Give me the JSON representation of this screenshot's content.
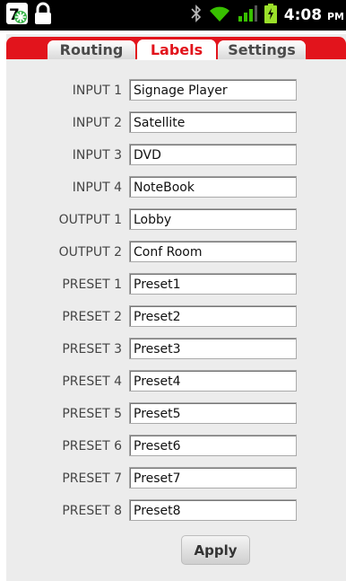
{
  "status_bar": {
    "time": "4:08",
    "ampm": "PM",
    "icons": [
      "launcher-icon",
      "lock-icon",
      "bluetooth-icon",
      "wifi-icon",
      "signal-icon",
      "battery-charging-icon"
    ]
  },
  "tabs": [
    {
      "label": "Routing",
      "active": false
    },
    {
      "label": "Labels",
      "active": true
    },
    {
      "label": "Settings",
      "active": false
    }
  ],
  "rows": [
    {
      "label": "INPUT 1",
      "value": "Signage Player"
    },
    {
      "label": "INPUT 2",
      "value": "Satellite"
    },
    {
      "label": "INPUT 3",
      "value": "DVD"
    },
    {
      "label": "INPUT 4",
      "value": "NoteBook"
    },
    {
      "label": "OUTPUT 1",
      "value": "Lobby"
    },
    {
      "label": "OUTPUT 2",
      "value": "Conf Room"
    },
    {
      "label": "PRESET 1",
      "value": "Preset1"
    },
    {
      "label": "PRESET 2",
      "value": "Preset2"
    },
    {
      "label": "PRESET 3",
      "value": "Preset3"
    },
    {
      "label": "PRESET 4",
      "value": "Preset4"
    },
    {
      "label": "PRESET 5",
      "value": "Preset5"
    },
    {
      "label": "PRESET 6",
      "value": "Preset6"
    },
    {
      "label": "PRESET 7",
      "value": "Preset7"
    },
    {
      "label": "PRESET 8",
      "value": "Preset8"
    }
  ],
  "apply_label": "Apply",
  "colors": {
    "accent": "#e2141c",
    "background": "#ececec",
    "statusbar": "#000000",
    "battery": "#9be02a"
  }
}
